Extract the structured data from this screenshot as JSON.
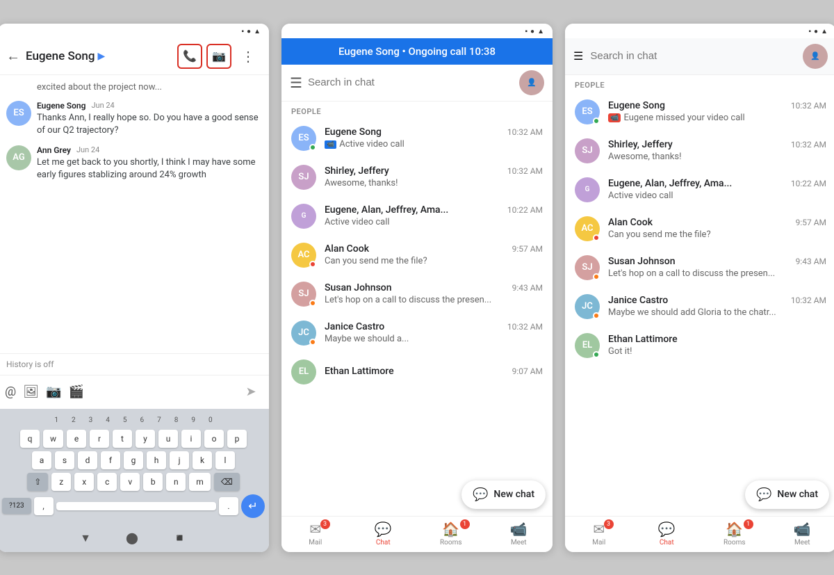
{
  "phone1": {
    "status_bar": "icons",
    "header": {
      "title": "Eugene Song",
      "chevron": "▶",
      "phone_icon": "📞",
      "video_icon": "📷",
      "more_icon": "⋮"
    },
    "messages": [
      {
        "id": "excited",
        "text": "excited about the project now..."
      },
      {
        "id": "eugene1",
        "sender": "Eugene Song",
        "date": "Jun 24",
        "text": "Thanks Ann, I really hope so. Do you have a good sense of our Q2 trajectory?"
      },
      {
        "id": "ann1",
        "sender": "Ann Grey",
        "date": "Jun 24",
        "text": "Let me get back to you shortly, I think I may have some early figures stablizing around 24% growth"
      }
    ],
    "history_off": "History is off",
    "input_icons": [
      "@",
      "🖼",
      "📷",
      "🎬"
    ],
    "keyboard": {
      "row_nums": [
        "1",
        "2",
        "3",
        "4",
        "5",
        "6",
        "7",
        "8",
        "9",
        "0"
      ],
      "row1": [
        "q",
        "w",
        "e",
        "r",
        "t",
        "y",
        "u",
        "i",
        "o",
        "p"
      ],
      "row2": [
        "a",
        "s",
        "d",
        "f",
        "g",
        "h",
        "j",
        "k",
        "l"
      ],
      "row3": [
        "z",
        "x",
        "c",
        "v",
        "b",
        "n",
        "m"
      ],
      "specials": [
        "?123",
        ",",
        ".",
        "⌫",
        "↵"
      ]
    }
  },
  "phone2": {
    "active_call_text": "Eugene Song • Ongoing call 10:38",
    "search_placeholder": "Search in chat",
    "section_label": "PEOPLE",
    "people": [
      {
        "name": "Eugene Song",
        "time": "10:32 AM",
        "msg": "Active video call",
        "has_video": true,
        "status": "online",
        "initials": "ES"
      },
      {
        "name": "Shirley, Jeffery",
        "time": "10:32 AM",
        "msg": "Awesome, thanks!",
        "has_video": false,
        "status": "none",
        "initials": "SJ"
      },
      {
        "name": "Eugene, Alan, Jeffrey, Ama...",
        "time": "10:22 AM",
        "msg": "Active video call",
        "has_video": false,
        "status": "none",
        "initials": "G"
      },
      {
        "name": "Alan Cook",
        "time": "9:57 AM",
        "msg": "Can you send me the file?",
        "has_video": false,
        "status": "busy",
        "initials": "AC"
      },
      {
        "name": "Susan Johnson",
        "time": "9:43 AM",
        "msg": "Let's hop on a call to discuss the presen...",
        "has_video": false,
        "status": "orange",
        "initials": "SJ"
      },
      {
        "name": "Janice Castro",
        "time": "10:32 AM",
        "msg": "Maybe we should a...",
        "has_video": false,
        "status": "orange",
        "initials": "JC"
      },
      {
        "name": "Ethan Lattimore",
        "time": "",
        "msg": "",
        "has_video": false,
        "status": "none",
        "initials": "EL"
      }
    ],
    "nav_tabs": [
      {
        "label": "Mail",
        "icon": "✉",
        "badge": "3",
        "active": false
      },
      {
        "label": "Chat",
        "icon": "💬",
        "badge": "",
        "active": true
      },
      {
        "label": "Rooms",
        "icon": "🏠",
        "badge": "1",
        "active": false
      },
      {
        "label": "Meet",
        "icon": "📹",
        "badge": "",
        "active": false
      }
    ],
    "new_chat_label": "New chat"
  },
  "phone3": {
    "search_placeholder": "Search in chat",
    "section_label": "PEOPLE",
    "people": [
      {
        "name": "Eugene Song",
        "time": "10:32 AM",
        "msg": "Eugene missed your video call",
        "has_missed": true,
        "status": "online",
        "initials": "ES"
      },
      {
        "name": "Shirley, Jeffery",
        "time": "10:32 AM",
        "msg": "Awesome, thanks!",
        "has_missed": false,
        "status": "none",
        "initials": "SJ"
      },
      {
        "name": "Eugene, Alan, Jeffrey, Ama...",
        "time": "10:22 AM",
        "msg": "Active video call",
        "has_missed": false,
        "status": "none",
        "initials": "G"
      },
      {
        "name": "Alan Cook",
        "time": "9:57 AM",
        "msg": "Can you send me the file?",
        "has_missed": false,
        "status": "busy",
        "initials": "AC"
      },
      {
        "name": "Susan Johnson",
        "time": "9:43 AM",
        "msg": "Let's hop on a call to discuss the presen...",
        "has_missed": false,
        "status": "orange",
        "initials": "SJ"
      },
      {
        "name": "Janice Castro",
        "time": "10:32 AM",
        "msg": "Maybe we should add Gloria to the chatr...",
        "has_missed": false,
        "status": "orange",
        "initials": "JC"
      },
      {
        "name": "Ethan Lattimore",
        "time": "",
        "msg": "Got it!",
        "has_missed": false,
        "status": "online",
        "initials": "EL"
      }
    ],
    "nav_tabs": [
      {
        "label": "Mail",
        "icon": "✉",
        "badge": "3",
        "active": false
      },
      {
        "label": "Chat",
        "icon": "💬",
        "badge": "",
        "active": true
      },
      {
        "label": "Rooms",
        "icon": "🏠",
        "badge": "1",
        "active": false
      },
      {
        "label": "Meet",
        "icon": "📹",
        "badge": "",
        "active": false
      }
    ],
    "new_chat_label": "New chat"
  },
  "colors": {
    "blue": "#1a73e8",
    "red": "#ea4335",
    "green": "#34a853",
    "text_primary": "#202124",
    "text_secondary": "#666"
  }
}
